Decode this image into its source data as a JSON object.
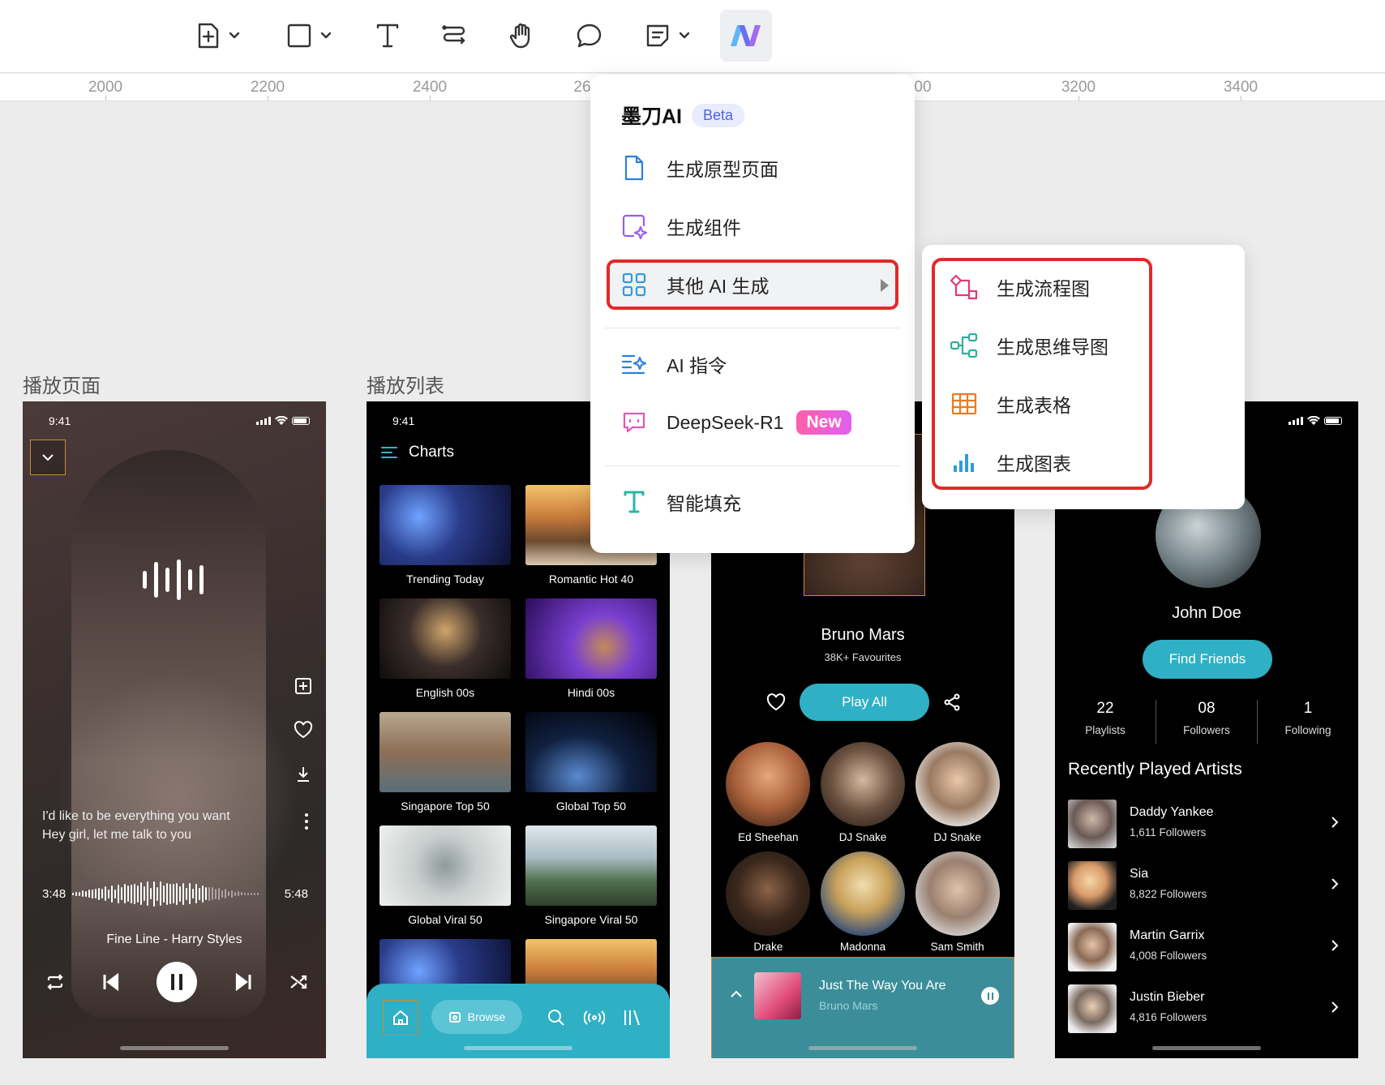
{
  "toolbar": {
    "tools": [
      "add-frame",
      "rectangle",
      "text",
      "connector",
      "hand",
      "comment",
      "note",
      "ai"
    ]
  },
  "ruler": {
    "ticks": [
      "2000",
      "2200",
      "2400",
      "26",
      "00",
      "3200",
      "3400"
    ]
  },
  "canvas": {
    "labels": {
      "player": "播放页面",
      "playlist": "播放列表"
    }
  },
  "player": {
    "time": "9:41",
    "lyrics": [
      "I'd like to be everything you want",
      "Hey girl, let me talk to you"
    ],
    "elapsed": "3:48",
    "duration": "5:48",
    "track": "Fine Line - Harry Styles"
  },
  "charts": {
    "time": "9:41",
    "title": "Charts",
    "items": [
      {
        "label": "Trending Today"
      },
      {
        "label": "Romantic Hot 40"
      },
      {
        "label": "English 00s"
      },
      {
        "label": "Hindi 00s"
      },
      {
        "label": "Singapore Top 50"
      },
      {
        "label": "Global Top 50"
      },
      {
        "label": "Global Viral 50"
      },
      {
        "label": "Singapore Viral 50"
      },
      {
        "label": ""
      },
      {
        "label": ""
      }
    ],
    "nav": {
      "browse": "Browse"
    }
  },
  "artist": {
    "name": "Bruno Mars",
    "favourites": "38K+ Favourites",
    "play_all": "Play All",
    "related": [
      {
        "name": "Ed Sheehan"
      },
      {
        "name": "DJ Snake"
      },
      {
        "name": "DJ Snake"
      },
      {
        "name": "Drake"
      },
      {
        "name": "Madonna"
      },
      {
        "name": "Sam Smith"
      }
    ],
    "mini_player": {
      "title": "Just The Way You Are",
      "artist": "Bruno Mars"
    }
  },
  "profile": {
    "name": "John Doe",
    "find_friends": "Find Friends",
    "stats": [
      {
        "value": "22",
        "label": "Playlists"
      },
      {
        "value": "08",
        "label": "Followers"
      },
      {
        "value": "1",
        "label": "Following"
      }
    ],
    "section_title": "Recently Played Artists",
    "recent": [
      {
        "name": "Daddy Yankee",
        "followers": "1,611 Followers"
      },
      {
        "name": "Sia",
        "followers": "8,822 Followers"
      },
      {
        "name": "Martin Garrix",
        "followers": "4,008 Followers"
      },
      {
        "name": "Justin Bieber",
        "followers": "4,816 Followers"
      }
    ]
  },
  "ai_menu": {
    "brand": "墨刀AI",
    "badge": "Beta",
    "items": [
      {
        "label": "生成原型页面",
        "icon": "document-icon"
      },
      {
        "label": "生成组件",
        "icon": "component-sparkle-icon"
      },
      {
        "label": "其他 AI 生成",
        "icon": "grid-icon"
      },
      {
        "label": "AI 指令",
        "icon": "command-icon"
      },
      {
        "label": "DeepSeek-R1",
        "icon": "chat-icon",
        "badge": "New"
      },
      {
        "label": "智能填充",
        "icon": "text-fill-icon"
      }
    ]
  },
  "sub_menu": {
    "items": [
      {
        "label": "生成流程图",
        "icon": "flowchart-icon"
      },
      {
        "label": "生成思维导图",
        "icon": "mindmap-icon"
      },
      {
        "label": "生成表格",
        "icon": "table-icon"
      },
      {
        "label": "生成图表",
        "icon": "bar-chart-icon"
      }
    ]
  },
  "colors": {
    "accent": "#2fb0c4",
    "highlight": "#e02a2a",
    "ai_brand": "#4d63e0"
  }
}
